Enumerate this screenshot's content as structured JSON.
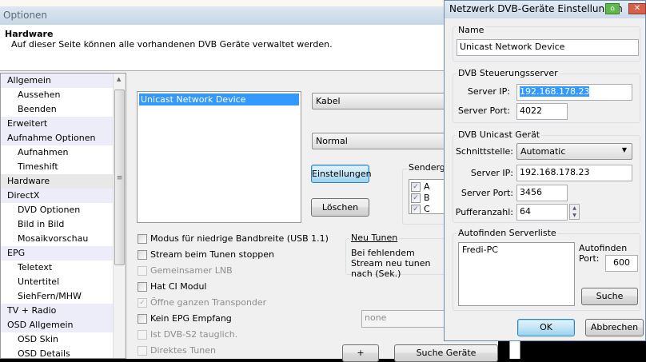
{
  "main": {
    "title": "Optionen",
    "header_title": "Hardware",
    "header_subtitle": "Auf dieser Seite können alle vorhandenen DVB Geräte verwaltet werden.",
    "sidebar": [
      {
        "label": "Allgemein",
        "level": 0
      },
      {
        "label": "Aussehen",
        "level": 1
      },
      {
        "label": "Beenden",
        "level": 1
      },
      {
        "label": "Erweitert",
        "level": 0
      },
      {
        "label": "Aufnahme Optionen",
        "level": 0
      },
      {
        "label": "Aufnahmen",
        "level": 1
      },
      {
        "label": "Timeshift",
        "level": 1
      },
      {
        "label": "Hardware",
        "level": 0,
        "selected": true
      },
      {
        "label": "DirectX",
        "level": 0
      },
      {
        "label": "DVD Optionen",
        "level": 1
      },
      {
        "label": "Bild in Bild",
        "level": 1
      },
      {
        "label": "Mosaikvorschau",
        "level": 1
      },
      {
        "label": "EPG",
        "level": 0
      },
      {
        "label": "Teletext",
        "level": 1
      },
      {
        "label": "Untertitel",
        "level": 1
      },
      {
        "label": "SiehFern/MHW",
        "level": 1
      },
      {
        "label": "TV + Radio",
        "level": 0
      },
      {
        "label": "OSD Allgemein",
        "level": 0
      },
      {
        "label": "OSD Skin",
        "level": 1
      },
      {
        "label": "OSD Details",
        "level": 1
      }
    ],
    "device_list": [
      "Unicast Network Device"
    ],
    "type_combo": "Kabel",
    "mode_combo": "Normal",
    "settings_button": "Einstellungen",
    "delete_button": "Löschen",
    "sendergruppe_label": "Sendergr",
    "sendergruppen": [
      {
        "label": "A",
        "checked": true
      },
      {
        "label": "B",
        "checked": true
      },
      {
        "label": "C",
        "checked": true
      }
    ],
    "options": [
      {
        "label": "Modus für niedrige Bandbreite (USB 1.1)",
        "checked": false,
        "enabled": true
      },
      {
        "label": "Stream beim Tunen stoppen",
        "checked": false,
        "enabled": true
      },
      {
        "label": "Gemeinsamer LNB",
        "checked": false,
        "enabled": false
      },
      {
        "label": "Hat CI Modul",
        "checked": false,
        "enabled": true
      },
      {
        "label": "Öffne ganzen Transponder",
        "checked": true,
        "enabled": false
      },
      {
        "label": "Kein EPG Empfang",
        "checked": false,
        "enabled": true
      },
      {
        "label": "Ist DVB-S2 tauglich.",
        "checked": false,
        "enabled": false
      },
      {
        "label": "Direktes Tunen",
        "checked": false,
        "enabled": false
      }
    ],
    "neu_tunen_label": "Neu Tunen",
    "neu_tunen_text": "Bei fehlendem Stream neu tunen nach (Sek.)",
    "none_combo": "none",
    "plus_button": "+",
    "search_devices_button": "Suche Geräte"
  },
  "dialog": {
    "title": "Netzwerk DVB-Geräte Einstellungen",
    "name_group": "Name",
    "name_value": "Unicast Network Device",
    "control_group": "DVB Steuerungsserver",
    "server_ip_label": "Server IP:",
    "control_ip": "192.168.178.23",
    "server_port_label": "Server Port:",
    "control_port": "4022",
    "unicast_group": "DVB Unicast Gerät",
    "interface_label": "Schnittstelle:",
    "interface_value": "Automatic",
    "unicast_ip": "192.168.178.23",
    "unicast_port": "3456",
    "buffer_label": "Pufferanzahl:",
    "buffer_value": "64",
    "autofind_group": "Autofinden Serverliste",
    "server_list": [
      "Fredi-PC"
    ],
    "autofind_port_label": "Autofinden Port:",
    "autofind_port": "600",
    "search_button": "Suche",
    "ok_button": "OK",
    "cancel_button": "Abbrechen"
  }
}
